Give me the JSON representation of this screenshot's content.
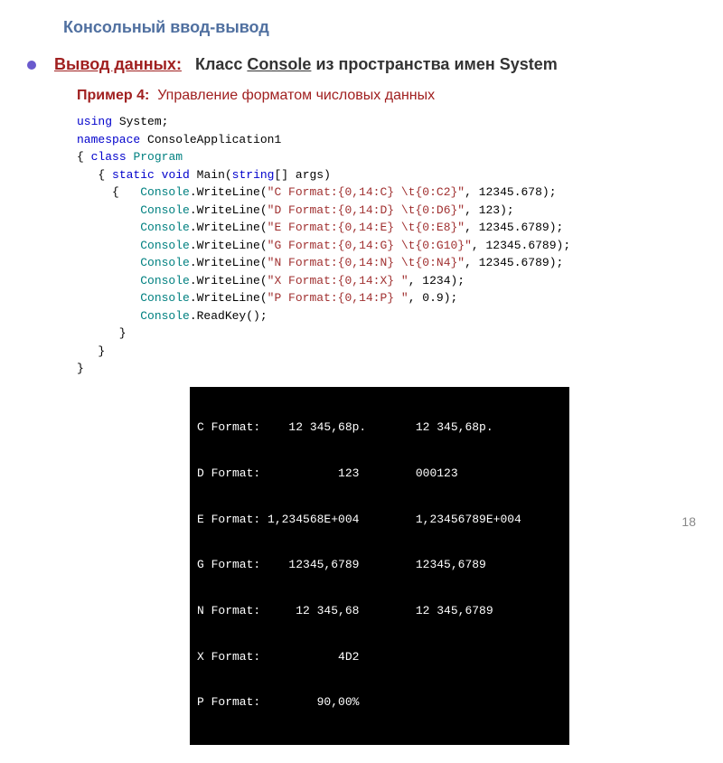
{
  "header": {
    "title": "Консольный ввод-вывод"
  },
  "subtitle": {
    "label": "Вывод данных:",
    "desc_prefix": "Класс ",
    "desc_underline": "Console",
    "desc_suffix": " из пространства имен System"
  },
  "example": {
    "label": "Пример 4:",
    "text": "Управление форматом числовых данных"
  },
  "code": {
    "l1a": "using",
    "l1b": " System;",
    "l2a": "namespace",
    "l2b": " ConsoleApplication1",
    "l3a": "{ ",
    "l3b": "class",
    "l3c": " ",
    "l3d": "Program",
    "l4a": "   { ",
    "l4b": "static",
    "l4c": " ",
    "l4d": "void",
    "l4e": " Main(",
    "l4f": "string",
    "l4g": "[] args)",
    "l5a": "     {   ",
    "l5b": "Console",
    "l5c": ".WriteLine(",
    "l5d": "\"C Format:{0,14:C} \\t{0:C2}\"",
    "l5e": ", 12345.678);",
    "l6a": "         ",
    "l6b": "Console",
    "l6c": ".WriteLine(",
    "l6d": "\"D Format:{0,14:D} \\t{0:D6}\"",
    "l6e": ", 123);",
    "l7a": "         ",
    "l7b": "Console",
    "l7c": ".WriteLine(",
    "l7d": "\"E Format:{0,14:E} \\t{0:E8}\"",
    "l7e": ", 12345.6789);",
    "l8a": "         ",
    "l8b": "Console",
    "l8c": ".WriteLine(",
    "l8d": "\"G Format:{0,14:G} \\t{0:G10}\"",
    "l8e": ", 12345.6789);",
    "l9a": "         ",
    "l9b": "Console",
    "l9c": ".WriteLine(",
    "l9d": "\"N Format:{0,14:N} \\t{0:N4}\"",
    "l9e": ", 12345.6789);",
    "l10a": "         ",
    "l10b": "Console",
    "l10c": ".WriteLine(",
    "l10d": "\"X Format:{0,14:X} \"",
    "l10e": ", 1234);",
    "l11a": "         ",
    "l11b": "Console",
    "l11c": ".WriteLine(",
    "l11d": "\"P Format:{0,14:P} \"",
    "l11e": ", 0.9);",
    "l12a": "         ",
    "l12b": "Console",
    "l12c": ".ReadKey();",
    "l13": "      }",
    "l14": "   }",
    "l15": "}"
  },
  "console": {
    "r1": "C Format:    12 345,68p.       12 345,68p.",
    "r2": "D Format:           123        000123",
    "r3": "E Format: 1,234568E+004        1,23456789E+004",
    "r4": "G Format:    12345,6789        12345,6789",
    "r5": "N Format:     12 345,68        12 345,6789",
    "r6": "X Format:           4D2",
    "r7": "P Format:        90,00%"
  },
  "page": "18"
}
